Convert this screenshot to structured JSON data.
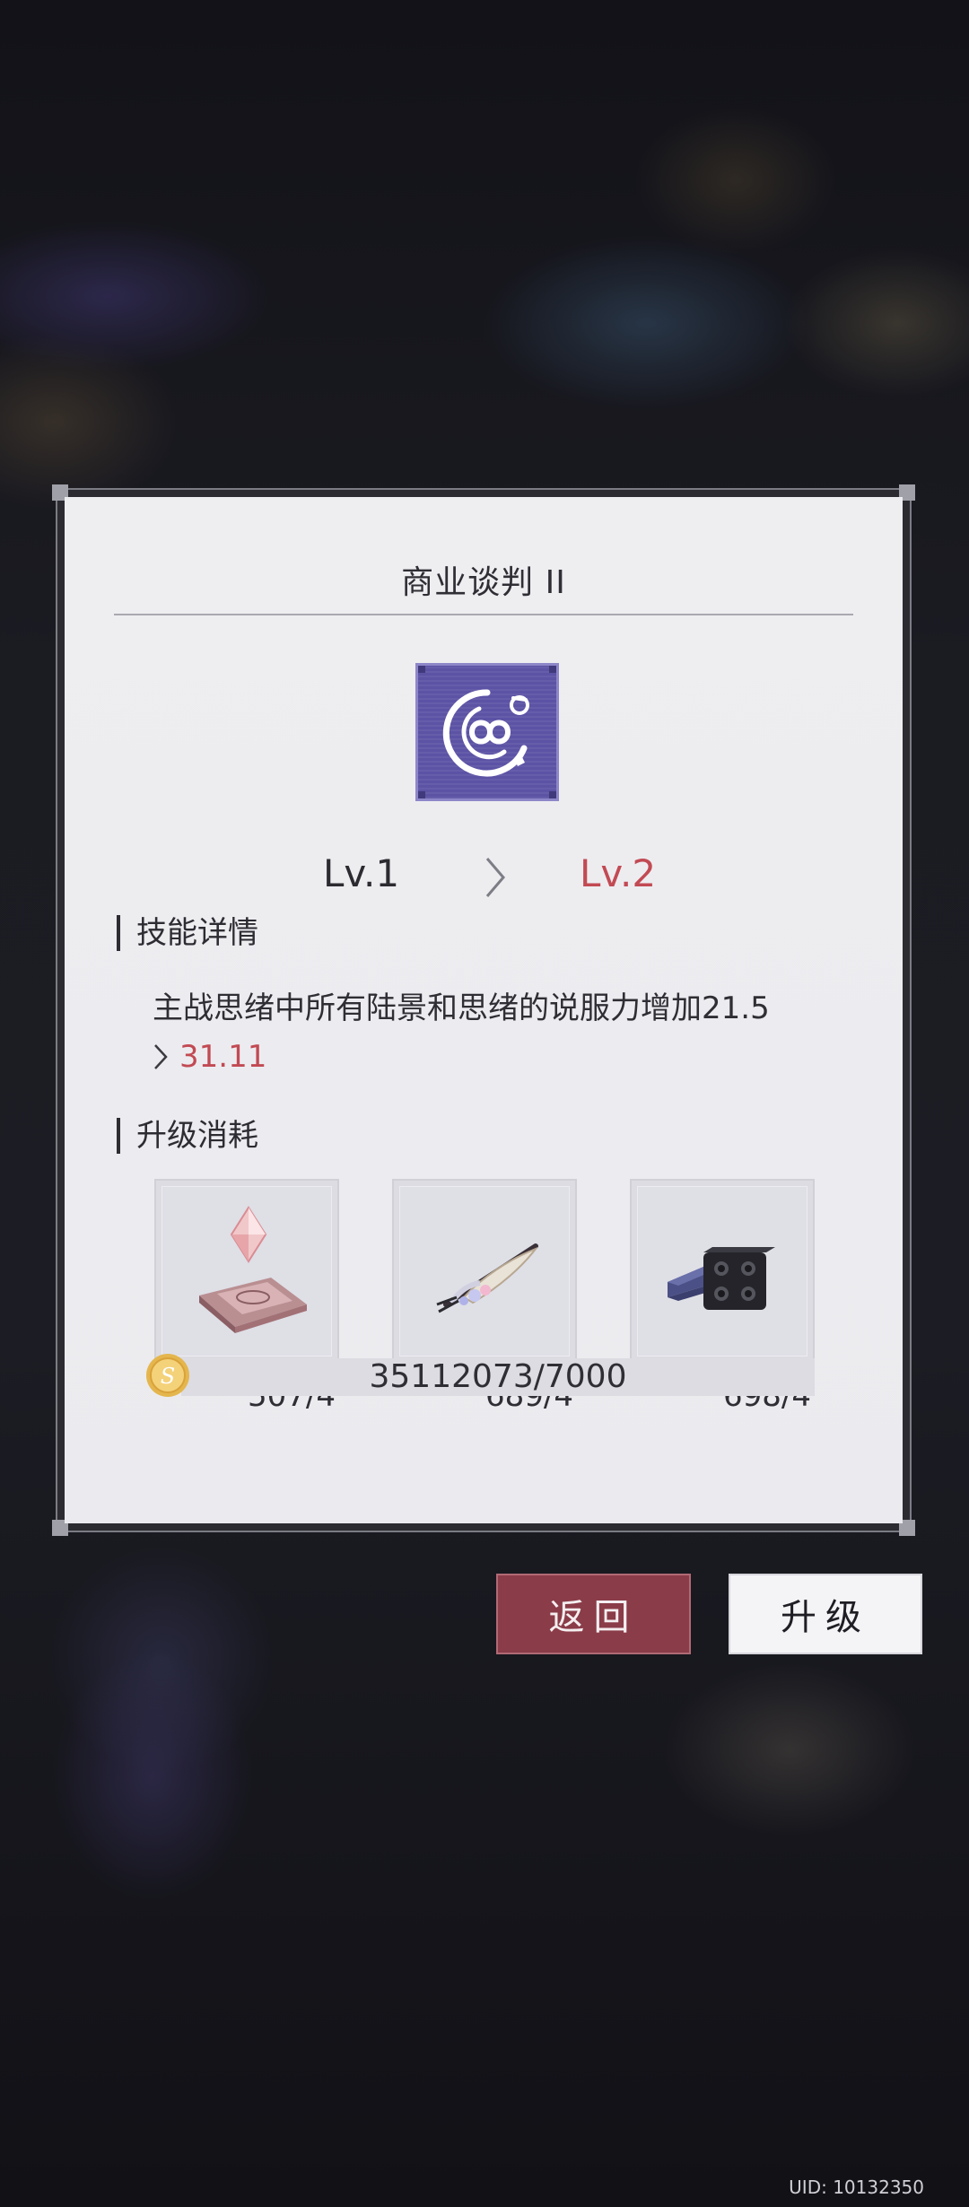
{
  "dialog": {
    "title": "商业谈判 II",
    "skill_icon": "infinity-skill-icon",
    "level_from": "Lv.1",
    "level_to": "Lv.2",
    "section_desc_label": "技能详情",
    "desc_text": "主战思绪中所有陆景和思绪的说服力增加21.5",
    "desc_new_value": "31.11",
    "section_cost_label": "升级消耗",
    "cost_items": [
      {
        "icon": "crystal-chip-icon",
        "count": "507/4"
      },
      {
        "icon": "feather-quill-icon",
        "count": "689/4"
      },
      {
        "icon": "building-block-icon",
        "count": "698/4"
      }
    ],
    "coin": {
      "icon": "coin-icon",
      "text": "35112073/7000"
    }
  },
  "buttons": {
    "back": "返回",
    "upgrade": "升级"
  },
  "uid": "UID: 10132350",
  "colors": {
    "accent_red": "#c24a53",
    "back_button": "#8a3c48",
    "skill_icon_bg": "#5c53a5"
  }
}
